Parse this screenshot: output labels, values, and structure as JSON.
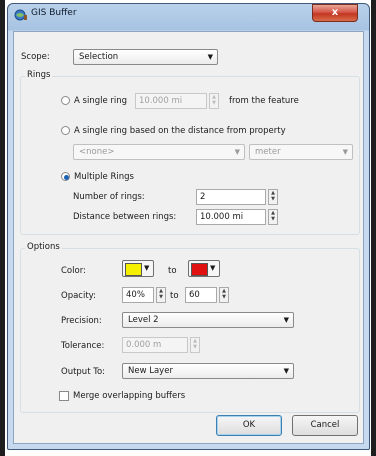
{
  "window": {
    "title": "GIS Buffer",
    "close_glyph": "x"
  },
  "scope": {
    "label": "Scope:",
    "value": "Selection"
  },
  "rings": {
    "group_label": "Rings",
    "single_ring": {
      "label": "A single ring",
      "value": "10.000 mi",
      "suffix": "from the feature",
      "checked": false
    },
    "property_ring": {
      "label": "A single ring based on the distance from property",
      "property_value": "<none>",
      "unit_value": "meter",
      "checked": false
    },
    "multiple_rings": {
      "label": "Multiple Rings",
      "checked": true,
      "number_label": "Number of rings:",
      "number_value": "2",
      "distance_label": "Distance between rings:",
      "distance_value": "10.000 mi"
    }
  },
  "options": {
    "group_label": "Options",
    "color": {
      "label": "Color:",
      "to_label": "to",
      "from_color": "#f5f000",
      "to_color": "#e01010"
    },
    "opacity": {
      "label": "Opacity:",
      "from_value": "40%",
      "to_label": "to",
      "to_value": "60"
    },
    "precision": {
      "label": "Precision:",
      "value": "Level 2"
    },
    "tolerance": {
      "label": "Tolerance:",
      "value": "0.000 m"
    },
    "output": {
      "label": "Output To:",
      "value": "New Layer"
    },
    "merge": {
      "label": "Merge overlapping buffers",
      "checked": false
    }
  },
  "buttons": {
    "ok": "OK",
    "cancel": "Cancel"
  },
  "icons": {
    "title": "globe-icon",
    "dropdown": "chevron-down-icon",
    "spin": "spinner-arrows-icon"
  }
}
